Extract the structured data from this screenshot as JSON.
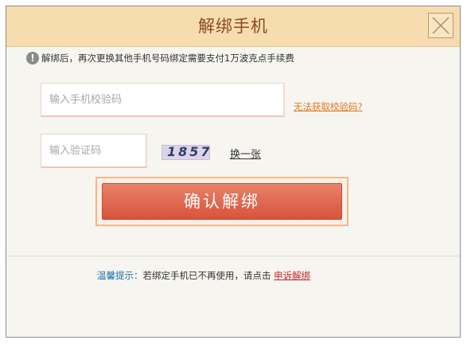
{
  "dialog": {
    "title": "解绑手机",
    "close_icon": "close-icon",
    "notice": "解绑后，再次更换其他手机号码绑定需要支付1万波克点手续费",
    "notice_icon": "!",
    "phone_code": {
      "placeholder": "输入手机校验码",
      "value": "",
      "help_link": "无法获取校验码?"
    },
    "captcha": {
      "placeholder": "输入验证码",
      "value": "",
      "image_text": "1857",
      "refresh_link": "换一张"
    },
    "confirm_button": "确认解绑",
    "tip": {
      "label": "温馨提示：",
      "text": "若绑定手机已不再使用，请点击",
      "link": "申诉解绑"
    }
  }
}
